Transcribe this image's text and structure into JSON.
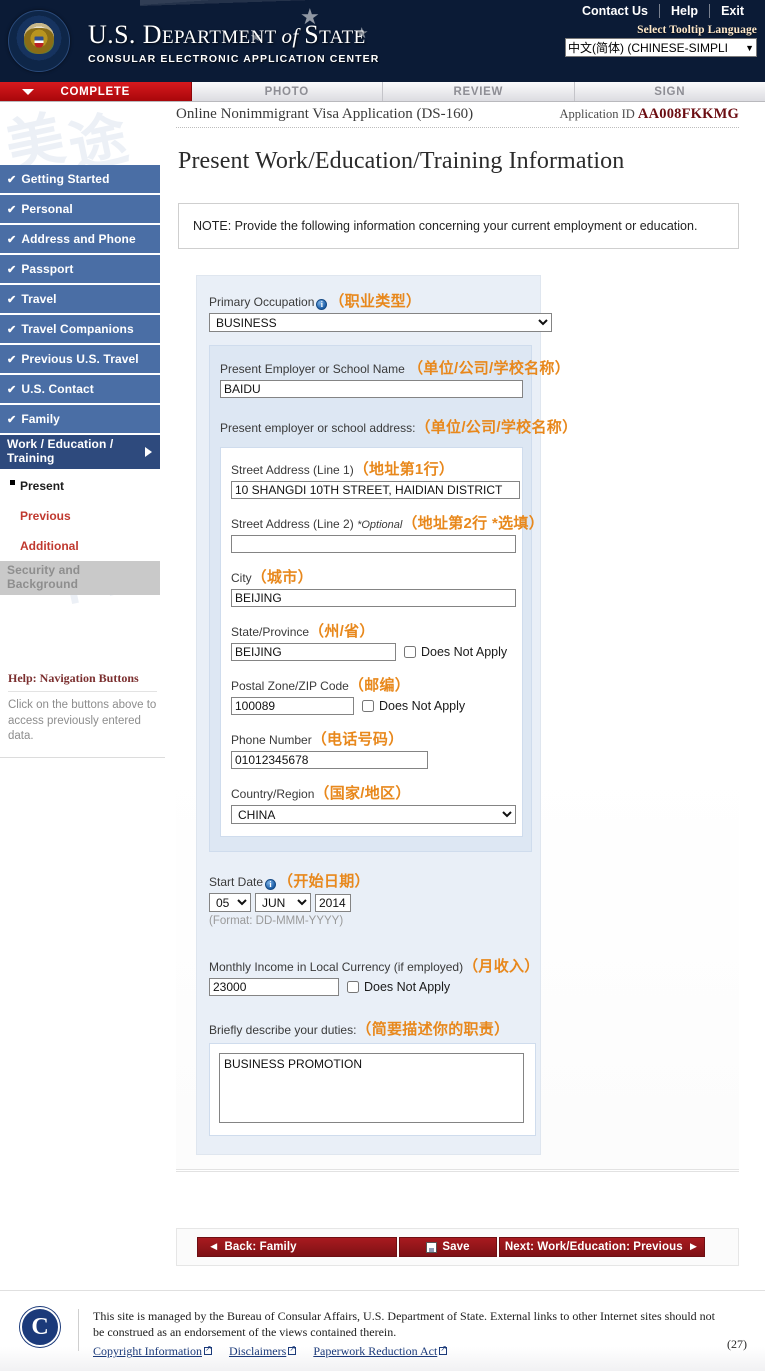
{
  "header": {
    "top_links": [
      "Contact Us",
      "Help",
      "Exit"
    ],
    "agency_line1_a": "U.S. ",
    "agency_line1_b": "D",
    "agency_line1_c": "EPARTMENT ",
    "agency_line1_d": "of ",
    "agency_line1_e": "S",
    "agency_line1_f": "TATE",
    "agency_line2": "CONSULAR ELECTRONIC APPLICATION CENTER",
    "tooltip_label": "Select Tooltip Language",
    "tooltip_value": "中文(简体)  (CHINESE-SIMPLI"
  },
  "stages": [
    {
      "label": "COMPLETE",
      "active": true
    },
    {
      "label": "PHOTO",
      "active": false
    },
    {
      "label": "REVIEW",
      "active": false
    },
    {
      "label": "SIGN",
      "active": false
    }
  ],
  "appstrip": {
    "form_title": "Online Nonimmigrant Visa Application (DS-160)",
    "app_id_label": "Application ID",
    "app_id_value": "AA008FKKMG"
  },
  "page": {
    "title": "Present Work/Education/Training Information",
    "note": "NOTE: Provide the following information concerning your current employment or education."
  },
  "sidebar": {
    "items": [
      {
        "label": "Getting Started",
        "check": "✔"
      },
      {
        "label": "Personal",
        "check": "✔"
      },
      {
        "label": "Address and Phone",
        "check": "✔"
      },
      {
        "label": "Passport",
        "check": "✔"
      },
      {
        "label": "Travel",
        "check": "✔"
      },
      {
        "label": "Travel Companions",
        "check": "✔"
      },
      {
        "label": "Previous U.S. Travel",
        "check": "✔"
      },
      {
        "label": "U.S. Contact",
        "check": "✔"
      },
      {
        "label": "Family",
        "check": "✔"
      }
    ],
    "current": "Work / Education / Training",
    "subitems": [
      {
        "label": "Present",
        "selected": true
      },
      {
        "label": "Previous",
        "selected": false
      },
      {
        "label": "Additional",
        "selected": false
      }
    ],
    "disabled_item": "Security and Background"
  },
  "help": {
    "title": "Help: Navigation Buttons",
    "body": "Click on the buttons above to access previously entered data."
  },
  "form": {
    "primary_occupation": {
      "label": "Primary Occupation",
      "zh": "（职业类型）",
      "value": "BUSINESS"
    },
    "employer_name": {
      "label": "Present Employer or School Name",
      "zh": "（单位/公司/学校名称）",
      "value": "BAIDU"
    },
    "address_heading": {
      "label": "Present employer or school address:",
      "zh": "（单位/公司/学校名称）"
    },
    "street1": {
      "label": "Street Address (Line 1)",
      "zh": "（地址第1行）",
      "value": "10 SHANGDI 10TH STREET, HAIDIAN DISTRICT"
    },
    "street2": {
      "label": "Street Address (Line 2) ",
      "optional": "*Optional",
      "zh": "（地址第2行 *选填）",
      "value": ""
    },
    "city": {
      "label": "City",
      "zh": "（城市）",
      "value": "BEIJING"
    },
    "state": {
      "label": "State/Province",
      "zh": "（州/省）",
      "value": "BEIJING",
      "dna_label": "Does Not Apply"
    },
    "postal": {
      "label": "Postal Zone/ZIP Code",
      "zh": "（邮编）",
      "value": "100089",
      "dna_label": "Does Not Apply"
    },
    "phone": {
      "label": "Phone Number",
      "zh": "（电话号码）",
      "value": "01012345678"
    },
    "country": {
      "label": "Country/Region",
      "zh": "（国家/地区）",
      "value": "CHINA"
    },
    "start_date": {
      "label": "Start Date",
      "zh": "（开始日期）",
      "day": "05",
      "month": "JUN",
      "year": "2014",
      "format_hint": "(Format: DD-MMM-YYYY)"
    },
    "income": {
      "label": "Monthly Income in Local Currency (if employed)",
      "zh": "（月收入）",
      "value": "23000",
      "dna_label": "Does Not Apply"
    },
    "duties": {
      "label": "Briefly describe your duties:",
      "zh": "（简要描述你的职责）",
      "value": "BUSINESS PROMOTION"
    }
  },
  "buttons": {
    "back": "Back: Family",
    "back_arrow": "◄",
    "save": "Save",
    "next": "Next: Work/Education: Previous",
    "next_arrow": "►"
  },
  "footer": {
    "text": "This site is managed by the Bureau of Consular Affairs, U.S. Department of State. External links to other Internet sites should not be construed as an endorsement of the views contained therein.",
    "links": [
      "Copyright Information",
      "Disclaimers",
      "Paperwork Reduction Act"
    ],
    "page_number": "(27)",
    "seal_letter": "C"
  },
  "watermarks": [
    "美",
    "途",
    "网",
    "美途网"
  ],
  "colors": {
    "accent_red": "#a81a1f",
    "nav_blue": "#4a6ea5",
    "nav_blue_active": "#2e4a7d",
    "zh_orange": "#e8881c",
    "panel_blue": "#e9eff7"
  }
}
